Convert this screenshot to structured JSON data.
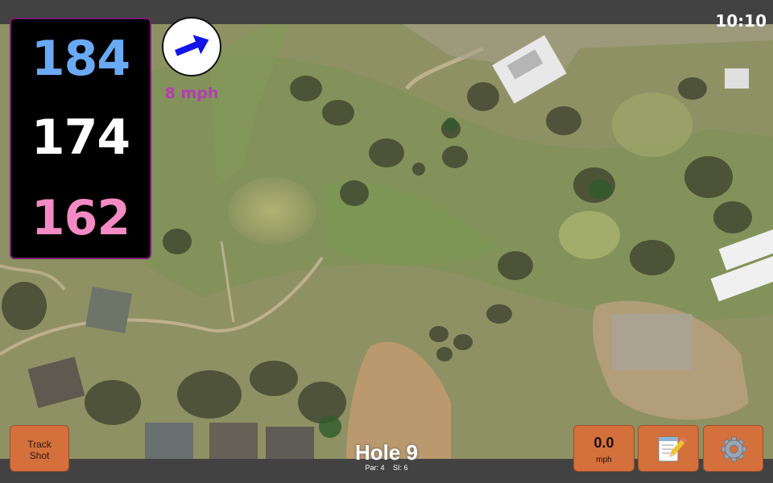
{
  "status_bar": {
    "time": "10:10"
  },
  "distances": {
    "back": "184",
    "middle": "174",
    "front": "162"
  },
  "wind": {
    "speed": "8 mph",
    "arrow_icon": "wind-arrow-icon",
    "arrow_color": "#1414e6"
  },
  "buttons": {
    "track_shot": "Track\nShot",
    "track_shot_line1": "Track",
    "track_shot_line2": "Shot",
    "speed_value": "0.0",
    "speed_unit": "mph",
    "notes_icon": "notepad-icon",
    "settings_icon": "gear-icon"
  },
  "hole": {
    "title": "Hole 9",
    "par": "Par: 4",
    "si": "SI: 6"
  },
  "colors": {
    "back_distance": "#6aaaf5",
    "middle_distance": "#ffffff",
    "front_distance": "#f48ac4",
    "button_fill": "#d4703c",
    "wind_text": "#b33fb0",
    "panel_border": "#7a1f6e"
  }
}
